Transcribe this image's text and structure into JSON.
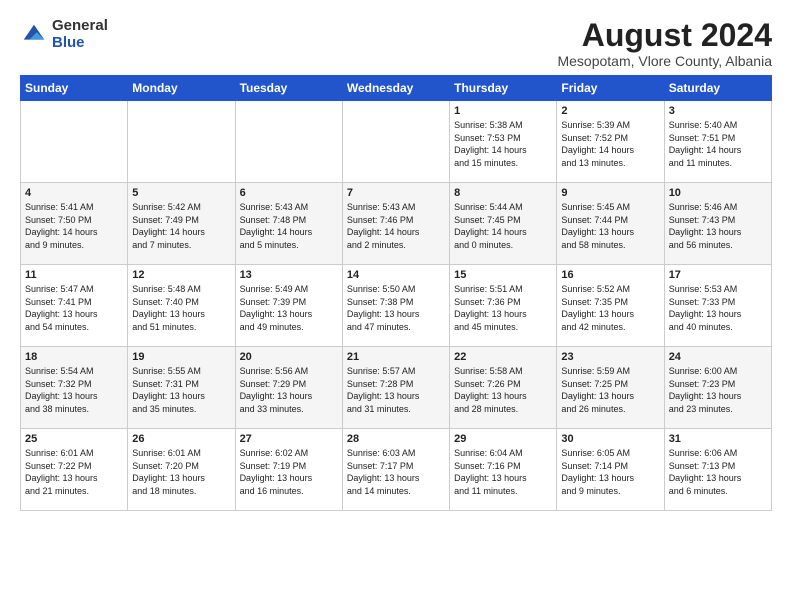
{
  "header": {
    "logo_general": "General",
    "logo_blue": "Blue",
    "month_year": "August 2024",
    "location": "Mesopotam, Vlore County, Albania"
  },
  "days_of_week": [
    "Sunday",
    "Monday",
    "Tuesday",
    "Wednesday",
    "Thursday",
    "Friday",
    "Saturday"
  ],
  "weeks": [
    [
      {
        "day": "",
        "content": ""
      },
      {
        "day": "",
        "content": ""
      },
      {
        "day": "",
        "content": ""
      },
      {
        "day": "",
        "content": ""
      },
      {
        "day": "1",
        "content": "Sunrise: 5:38 AM\nSunset: 7:53 PM\nDaylight: 14 hours\nand 15 minutes."
      },
      {
        "day": "2",
        "content": "Sunrise: 5:39 AM\nSunset: 7:52 PM\nDaylight: 14 hours\nand 13 minutes."
      },
      {
        "day": "3",
        "content": "Sunrise: 5:40 AM\nSunset: 7:51 PM\nDaylight: 14 hours\nand 11 minutes."
      }
    ],
    [
      {
        "day": "4",
        "content": "Sunrise: 5:41 AM\nSunset: 7:50 PM\nDaylight: 14 hours\nand 9 minutes."
      },
      {
        "day": "5",
        "content": "Sunrise: 5:42 AM\nSunset: 7:49 PM\nDaylight: 14 hours\nand 7 minutes."
      },
      {
        "day": "6",
        "content": "Sunrise: 5:43 AM\nSunset: 7:48 PM\nDaylight: 14 hours\nand 5 minutes."
      },
      {
        "day": "7",
        "content": "Sunrise: 5:43 AM\nSunset: 7:46 PM\nDaylight: 14 hours\nand 2 minutes."
      },
      {
        "day": "8",
        "content": "Sunrise: 5:44 AM\nSunset: 7:45 PM\nDaylight: 14 hours\nand 0 minutes."
      },
      {
        "day": "9",
        "content": "Sunrise: 5:45 AM\nSunset: 7:44 PM\nDaylight: 13 hours\nand 58 minutes."
      },
      {
        "day": "10",
        "content": "Sunrise: 5:46 AM\nSunset: 7:43 PM\nDaylight: 13 hours\nand 56 minutes."
      }
    ],
    [
      {
        "day": "11",
        "content": "Sunrise: 5:47 AM\nSunset: 7:41 PM\nDaylight: 13 hours\nand 54 minutes."
      },
      {
        "day": "12",
        "content": "Sunrise: 5:48 AM\nSunset: 7:40 PM\nDaylight: 13 hours\nand 51 minutes."
      },
      {
        "day": "13",
        "content": "Sunrise: 5:49 AM\nSunset: 7:39 PM\nDaylight: 13 hours\nand 49 minutes."
      },
      {
        "day": "14",
        "content": "Sunrise: 5:50 AM\nSunset: 7:38 PM\nDaylight: 13 hours\nand 47 minutes."
      },
      {
        "day": "15",
        "content": "Sunrise: 5:51 AM\nSunset: 7:36 PM\nDaylight: 13 hours\nand 45 minutes."
      },
      {
        "day": "16",
        "content": "Sunrise: 5:52 AM\nSunset: 7:35 PM\nDaylight: 13 hours\nand 42 minutes."
      },
      {
        "day": "17",
        "content": "Sunrise: 5:53 AM\nSunset: 7:33 PM\nDaylight: 13 hours\nand 40 minutes."
      }
    ],
    [
      {
        "day": "18",
        "content": "Sunrise: 5:54 AM\nSunset: 7:32 PM\nDaylight: 13 hours\nand 38 minutes."
      },
      {
        "day": "19",
        "content": "Sunrise: 5:55 AM\nSunset: 7:31 PM\nDaylight: 13 hours\nand 35 minutes."
      },
      {
        "day": "20",
        "content": "Sunrise: 5:56 AM\nSunset: 7:29 PM\nDaylight: 13 hours\nand 33 minutes."
      },
      {
        "day": "21",
        "content": "Sunrise: 5:57 AM\nSunset: 7:28 PM\nDaylight: 13 hours\nand 31 minutes."
      },
      {
        "day": "22",
        "content": "Sunrise: 5:58 AM\nSunset: 7:26 PM\nDaylight: 13 hours\nand 28 minutes."
      },
      {
        "day": "23",
        "content": "Sunrise: 5:59 AM\nSunset: 7:25 PM\nDaylight: 13 hours\nand 26 minutes."
      },
      {
        "day": "24",
        "content": "Sunrise: 6:00 AM\nSunset: 7:23 PM\nDaylight: 13 hours\nand 23 minutes."
      }
    ],
    [
      {
        "day": "25",
        "content": "Sunrise: 6:01 AM\nSunset: 7:22 PM\nDaylight: 13 hours\nand 21 minutes."
      },
      {
        "day": "26",
        "content": "Sunrise: 6:01 AM\nSunset: 7:20 PM\nDaylight: 13 hours\nand 18 minutes."
      },
      {
        "day": "27",
        "content": "Sunrise: 6:02 AM\nSunset: 7:19 PM\nDaylight: 13 hours\nand 16 minutes."
      },
      {
        "day": "28",
        "content": "Sunrise: 6:03 AM\nSunset: 7:17 PM\nDaylight: 13 hours\nand 14 minutes."
      },
      {
        "day": "29",
        "content": "Sunrise: 6:04 AM\nSunset: 7:16 PM\nDaylight: 13 hours\nand 11 minutes."
      },
      {
        "day": "30",
        "content": "Sunrise: 6:05 AM\nSunset: 7:14 PM\nDaylight: 13 hours\nand 9 minutes."
      },
      {
        "day": "31",
        "content": "Sunrise: 6:06 AM\nSunset: 7:13 PM\nDaylight: 13 hours\nand 6 minutes."
      }
    ]
  ]
}
